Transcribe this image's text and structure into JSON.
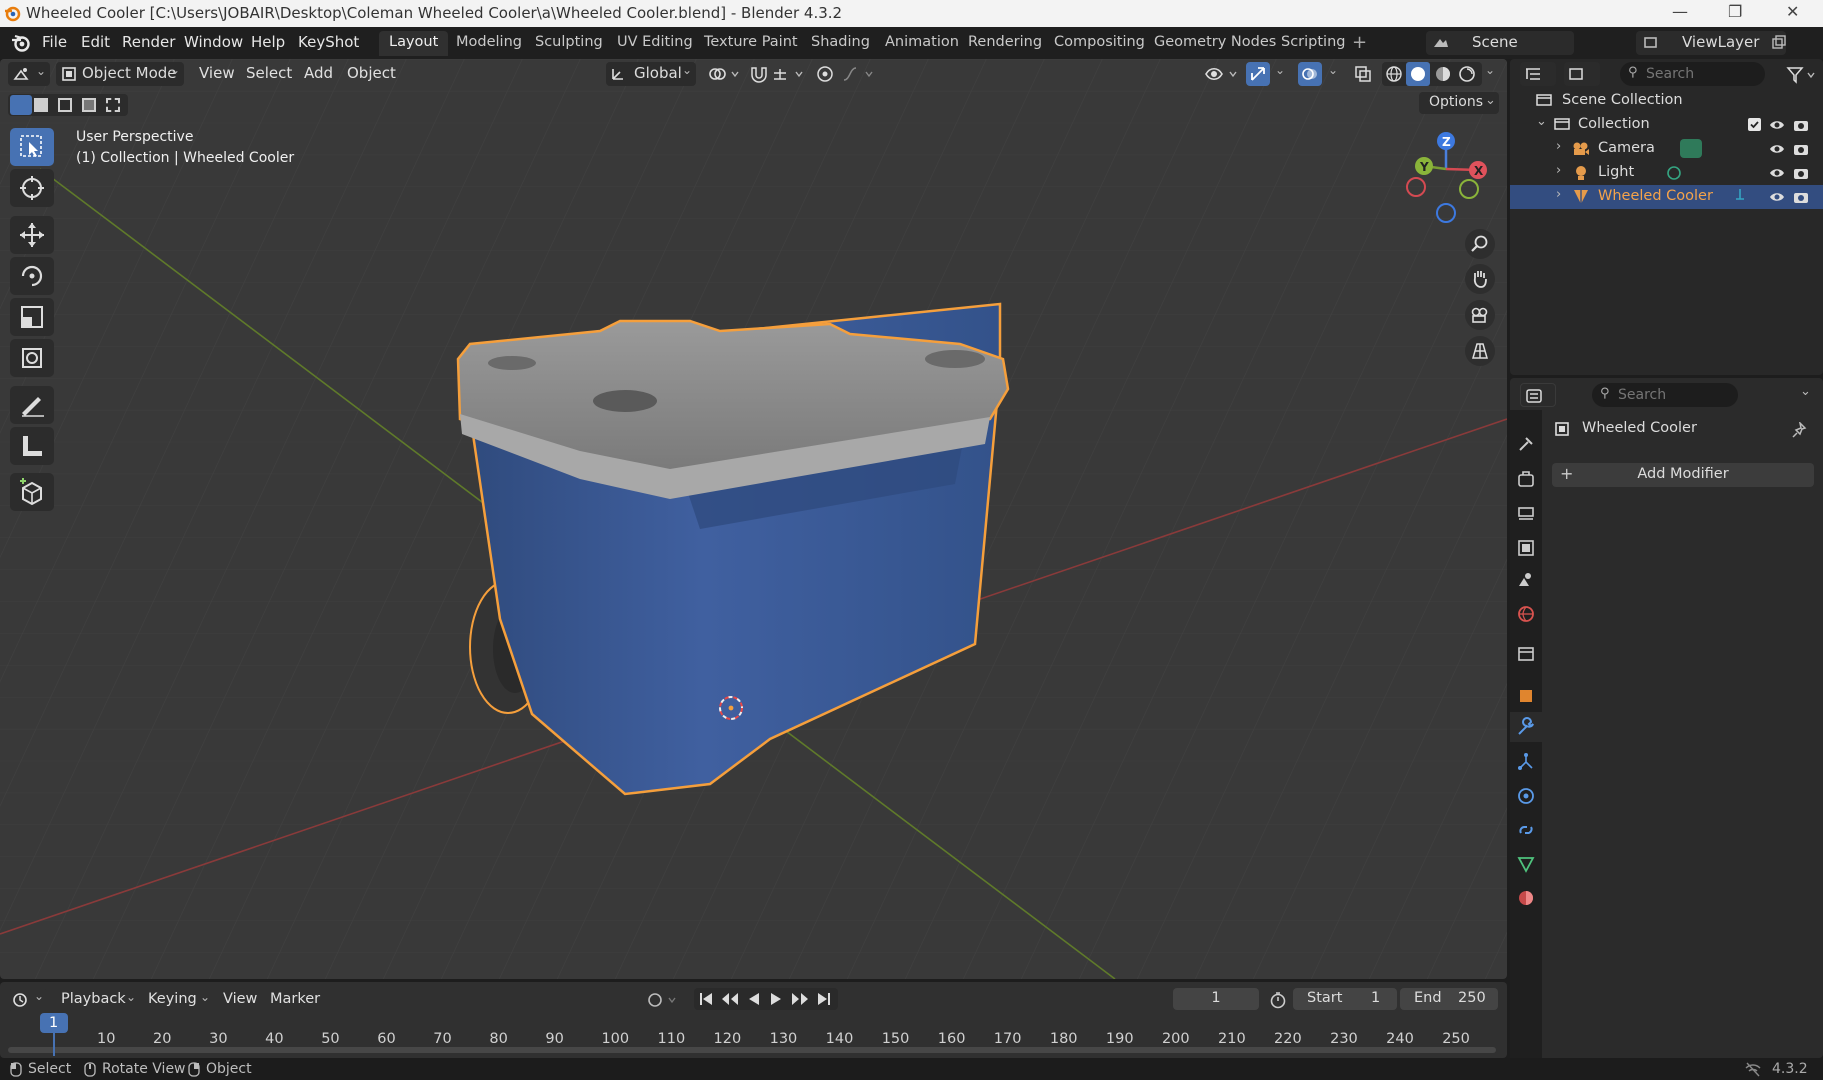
{
  "window": {
    "title": "Wheeled Cooler [C:\\Users\\JOBAIR\\Desktop\\Coleman Wheeled Cooler\\a\\Wheeled Cooler.blend] - Blender 4.3.2",
    "minimize": "—",
    "maximize": "❐",
    "close": "✕"
  },
  "menu": {
    "items": [
      "File",
      "Edit",
      "Render",
      "Window",
      "Help",
      "KeyShot"
    ],
    "workspaces": [
      "Layout",
      "Modeling",
      "Sculpting",
      "UV Editing",
      "Texture Paint",
      "Shading",
      "Animation",
      "Rendering",
      "Compositing",
      "Geometry Nodes",
      "Scripting"
    ],
    "add_workspace": "+",
    "scene_label": "Scene",
    "view_layer_label": "ViewLayer"
  },
  "viewport_header": {
    "mode": "Object Mode",
    "menus": [
      "View",
      "Select",
      "Add",
      "Object"
    ],
    "orientation": "Global",
    "options": "Options"
  },
  "viewport": {
    "perspective": "User Perspective",
    "collection_info": "(1) Collection | Wheeled Cooler",
    "gizmo": {
      "z": "Z",
      "y": "Y",
      "x": "X"
    }
  },
  "outliner": {
    "search_placeholder": "Search",
    "root": "Scene Collection",
    "collection": "Collection",
    "items": [
      {
        "name": "Camera",
        "icon": "camera-icon",
        "color": "#e59b4b"
      },
      {
        "name": "Light",
        "icon": "light-icon",
        "color": "#e59b4b"
      },
      {
        "name": "Wheeled Cooler",
        "icon": "mesh-icon",
        "color": "#e59b4b",
        "selected": true
      }
    ]
  },
  "properties": {
    "search_placeholder": "Search",
    "object_name": "Wheeled Cooler",
    "add_modifier": "Add Modifier"
  },
  "timeline": {
    "menus": [
      "Playback",
      "Keying",
      "View",
      "Marker"
    ],
    "current_frame": "1",
    "start_label": "Start",
    "start_value": "1",
    "end_label": "End",
    "end_value": "250",
    "ticks": [
      "1",
      "10",
      "20",
      "30",
      "40",
      "50",
      "60",
      "70",
      "80",
      "90",
      "100",
      "110",
      "120",
      "130",
      "140",
      "150",
      "160",
      "170",
      "180",
      "190",
      "200",
      "210",
      "220",
      "230",
      "240",
      "250"
    ]
  },
  "statusbar": {
    "select": "Select",
    "rotate_view": "Rotate View",
    "object": "Object",
    "version": "4.3.2"
  },
  "colors": {
    "accent": "#4772b3",
    "selection_outline": "#f59f3c",
    "cooler_body": "#3b5a92",
    "cooler_lid": "#8a8a8a"
  }
}
